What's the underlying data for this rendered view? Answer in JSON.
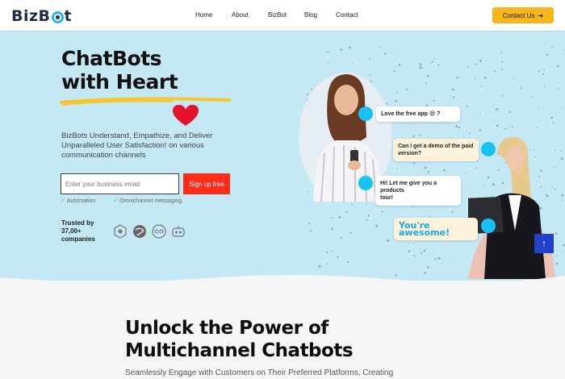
{
  "header": {
    "logo_text_1": "BizB",
    "logo_text_2": "t",
    "nav": [
      "Home",
      "About",
      "BizBot",
      "Blog",
      "Contact"
    ],
    "contact_label": "Contact Us",
    "contact_icon": "arrow-right-icon"
  },
  "hero": {
    "title_line1": "ChatBots",
    "title_line2": "with Heart",
    "heart_icon": "heart-icon",
    "description": "BizBots Understand, Empathize, and Deliver Unparalleled User Satisfaction! on various communication channels",
    "email_placeholder": "Enter your business email",
    "signup_label": "Sign up free",
    "features": [
      "Automation",
      "Omnichannel messaging"
    ],
    "trusted_line1": "Trusted by",
    "trusted_line2": "37,00+",
    "trusted_line3": "companies",
    "chat": {
      "msg1": "Love the free app 😄 ?",
      "msg2_line1": "Can i get a demo of the paid",
      "msg2_line2": "version?",
      "msg3_line1": "Hi! Let me give you a products",
      "msg3_line2": "tour!",
      "msg4": "You're awesome!"
    },
    "accent_colors": {
      "hero_bg": "#c4e9f5",
      "signup": "#ff2d17",
      "contact": "#f7b51c",
      "dot": "#19c2f5"
    }
  },
  "section2": {
    "title_line1": "Unlock the Power of",
    "title_line2": "Multichannel Chatbots",
    "subtitle": "Seamlessly Engage with Customers on Their Preferred Platforms, Creating"
  }
}
